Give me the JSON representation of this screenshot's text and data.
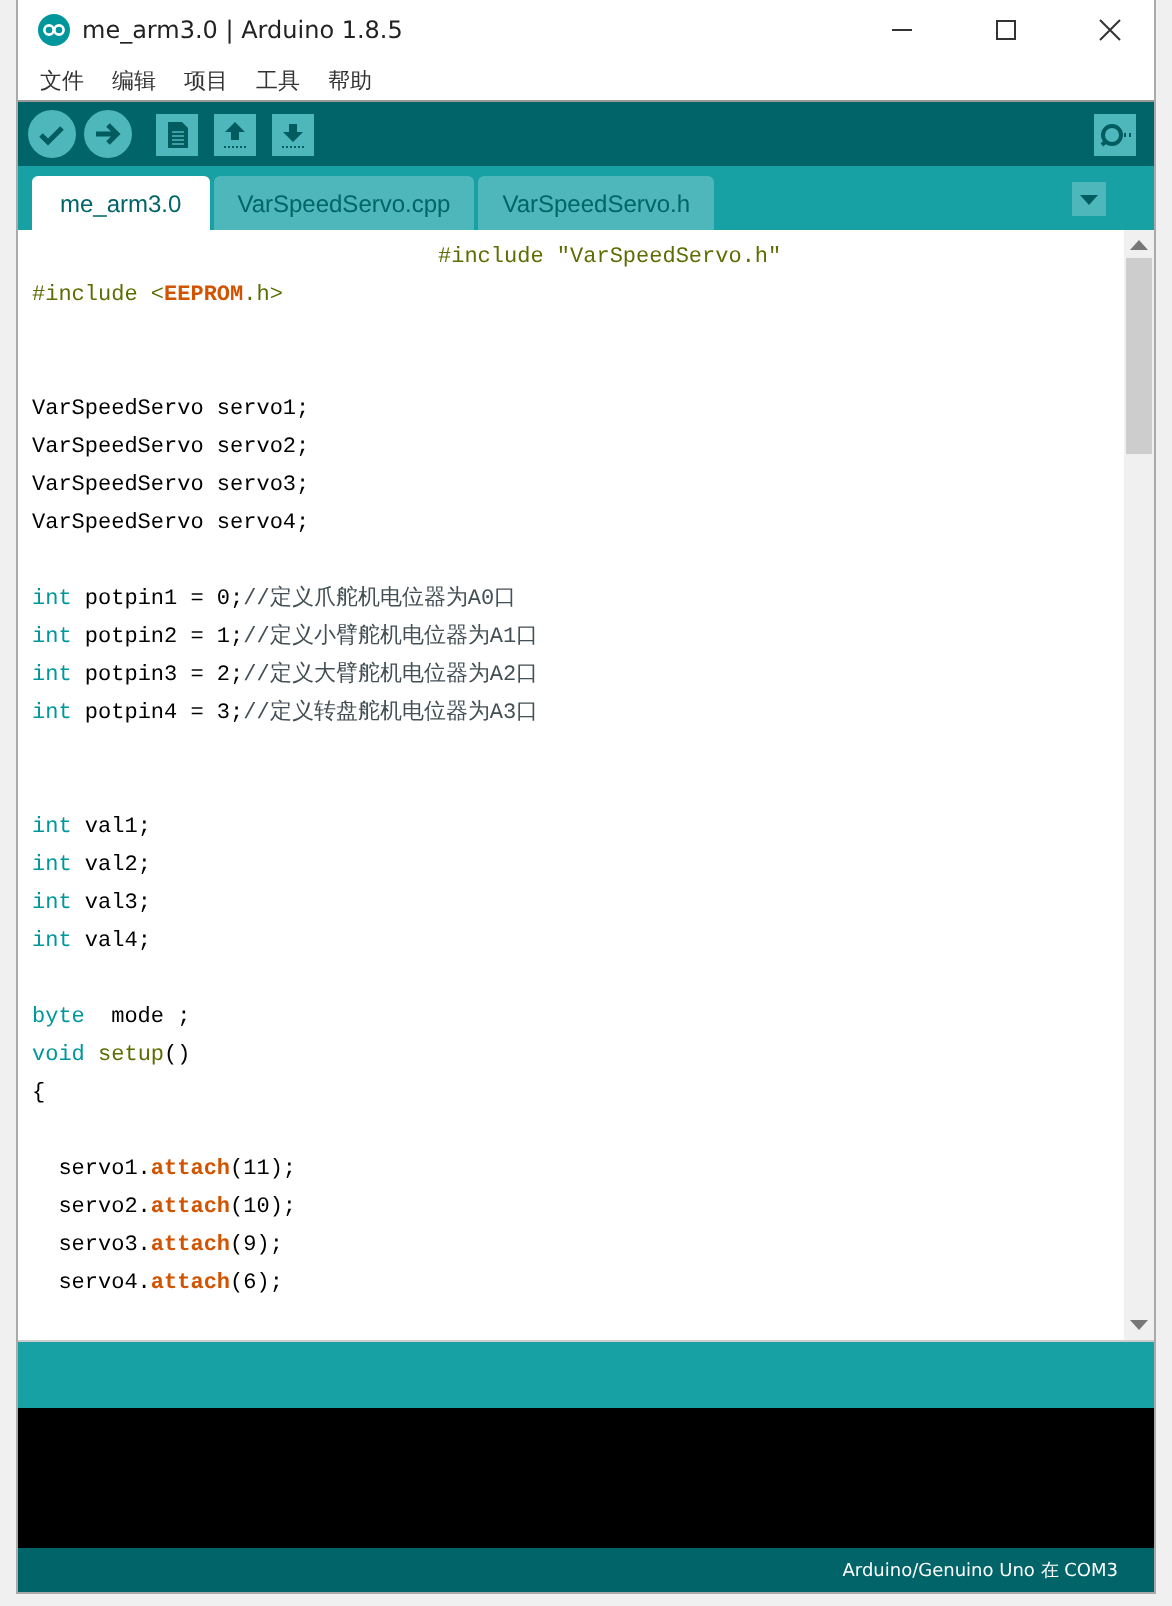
{
  "window": {
    "title": "me_arm3.0 | Arduino 1.8.5"
  },
  "menu": [
    "文件",
    "编辑",
    "项目",
    "工具",
    "帮助"
  ],
  "tabs": [
    {
      "label": "me_arm3.0",
      "selected": true
    },
    {
      "label": "VarSpeedServo.cpp",
      "selected": false
    },
    {
      "label": "VarSpeedServo.h",
      "selected": false
    }
  ],
  "code": [
    {
      "kind": "centered",
      "tokens": [
        {
          "kind": "directive",
          "text": "#include \"VarSpeedServo.h\""
        }
      ]
    },
    {
      "kind": "code",
      "tokens": [
        {
          "kind": "directive",
          "text": "#include <"
        },
        {
          "kind": "library",
          "text": "EEPROM"
        },
        {
          "kind": "directive",
          "text": ".h>"
        }
      ]
    },
    {
      "kind": "blank"
    },
    {
      "kind": "blank"
    },
    {
      "kind": "code",
      "tokens": [
        {
          "kind": "plain",
          "text": "VarSpeedServo servo1;"
        }
      ]
    },
    {
      "kind": "code",
      "tokens": [
        {
          "kind": "plain",
          "text": "VarSpeedServo servo2;"
        }
      ]
    },
    {
      "kind": "code",
      "tokens": [
        {
          "kind": "plain",
          "text": "VarSpeedServo servo3;"
        }
      ]
    },
    {
      "kind": "code",
      "tokens": [
        {
          "kind": "plain",
          "text": "VarSpeedServo servo4;"
        }
      ]
    },
    {
      "kind": "blank"
    },
    {
      "kind": "code",
      "tokens": [
        {
          "kind": "type",
          "text": "int"
        },
        {
          "kind": "plain",
          "text": " potpin1 = 0;"
        },
        {
          "kind": "comment",
          "text": "//定义爪舵机电位器为A0口"
        }
      ]
    },
    {
      "kind": "code",
      "tokens": [
        {
          "kind": "type",
          "text": "int"
        },
        {
          "kind": "plain",
          "text": " potpin2 = 1;"
        },
        {
          "kind": "comment",
          "text": "//定义小臂舵机电位器为A1口"
        }
      ]
    },
    {
      "kind": "code",
      "tokens": [
        {
          "kind": "type",
          "text": "int"
        },
        {
          "kind": "plain",
          "text": " potpin3 = 2;"
        },
        {
          "kind": "comment",
          "text": "//定义大臂舵机电位器为A2口"
        }
      ]
    },
    {
      "kind": "code",
      "tokens": [
        {
          "kind": "type",
          "text": "int"
        },
        {
          "kind": "plain",
          "text": " potpin4 = 3;"
        },
        {
          "kind": "comment",
          "text": "//定义转盘舵机电位器为A3口"
        }
      ]
    },
    {
      "kind": "blank"
    },
    {
      "kind": "blank"
    },
    {
      "kind": "code",
      "tokens": [
        {
          "kind": "type",
          "text": "int"
        },
        {
          "kind": "plain",
          "text": " val1;"
        }
      ]
    },
    {
      "kind": "code",
      "tokens": [
        {
          "kind": "type",
          "text": "int"
        },
        {
          "kind": "plain",
          "text": " val2;"
        }
      ]
    },
    {
      "kind": "code",
      "tokens": [
        {
          "kind": "type",
          "text": "int"
        },
        {
          "kind": "plain",
          "text": " val3;"
        }
      ]
    },
    {
      "kind": "code",
      "tokens": [
        {
          "kind": "type",
          "text": "int"
        },
        {
          "kind": "plain",
          "text": " val4;"
        }
      ]
    },
    {
      "kind": "blank"
    },
    {
      "kind": "code",
      "tokens": [
        {
          "kind": "type",
          "text": "byte"
        },
        {
          "kind": "plain",
          "text": "  mode ;"
        }
      ]
    },
    {
      "kind": "code",
      "tokens": [
        {
          "kind": "type",
          "text": "void "
        },
        {
          "kind": "function",
          "text": "setup"
        },
        {
          "kind": "plain",
          "text": "()"
        }
      ]
    },
    {
      "kind": "code",
      "tokens": [
        {
          "kind": "plain",
          "text": "{"
        }
      ]
    },
    {
      "kind": "blank"
    },
    {
      "kind": "code",
      "tokens": [
        {
          "kind": "plain",
          "text": "  servo1."
        },
        {
          "kind": "library",
          "text": "attach"
        },
        {
          "kind": "plain",
          "text": "(11);"
        }
      ]
    },
    {
      "kind": "code",
      "tokens": [
        {
          "kind": "plain",
          "text": "  servo2."
        },
        {
          "kind": "library",
          "text": "attach"
        },
        {
          "kind": "plain",
          "text": "(10);"
        }
      ]
    },
    {
      "kind": "code",
      "tokens": [
        {
          "kind": "plain",
          "text": "  servo3."
        },
        {
          "kind": "library",
          "text": "attach"
        },
        {
          "kind": "plain",
          "text": "(9);"
        }
      ]
    },
    {
      "kind": "code",
      "tokens": [
        {
          "kind": "plain",
          "text": "  servo4."
        },
        {
          "kind": "library",
          "text": "attach"
        },
        {
          "kind": "plain",
          "text": "(6);"
        }
      ]
    }
  ],
  "status_bar": {
    "board": "Arduino/Genuino Uno 在 COM3"
  }
}
